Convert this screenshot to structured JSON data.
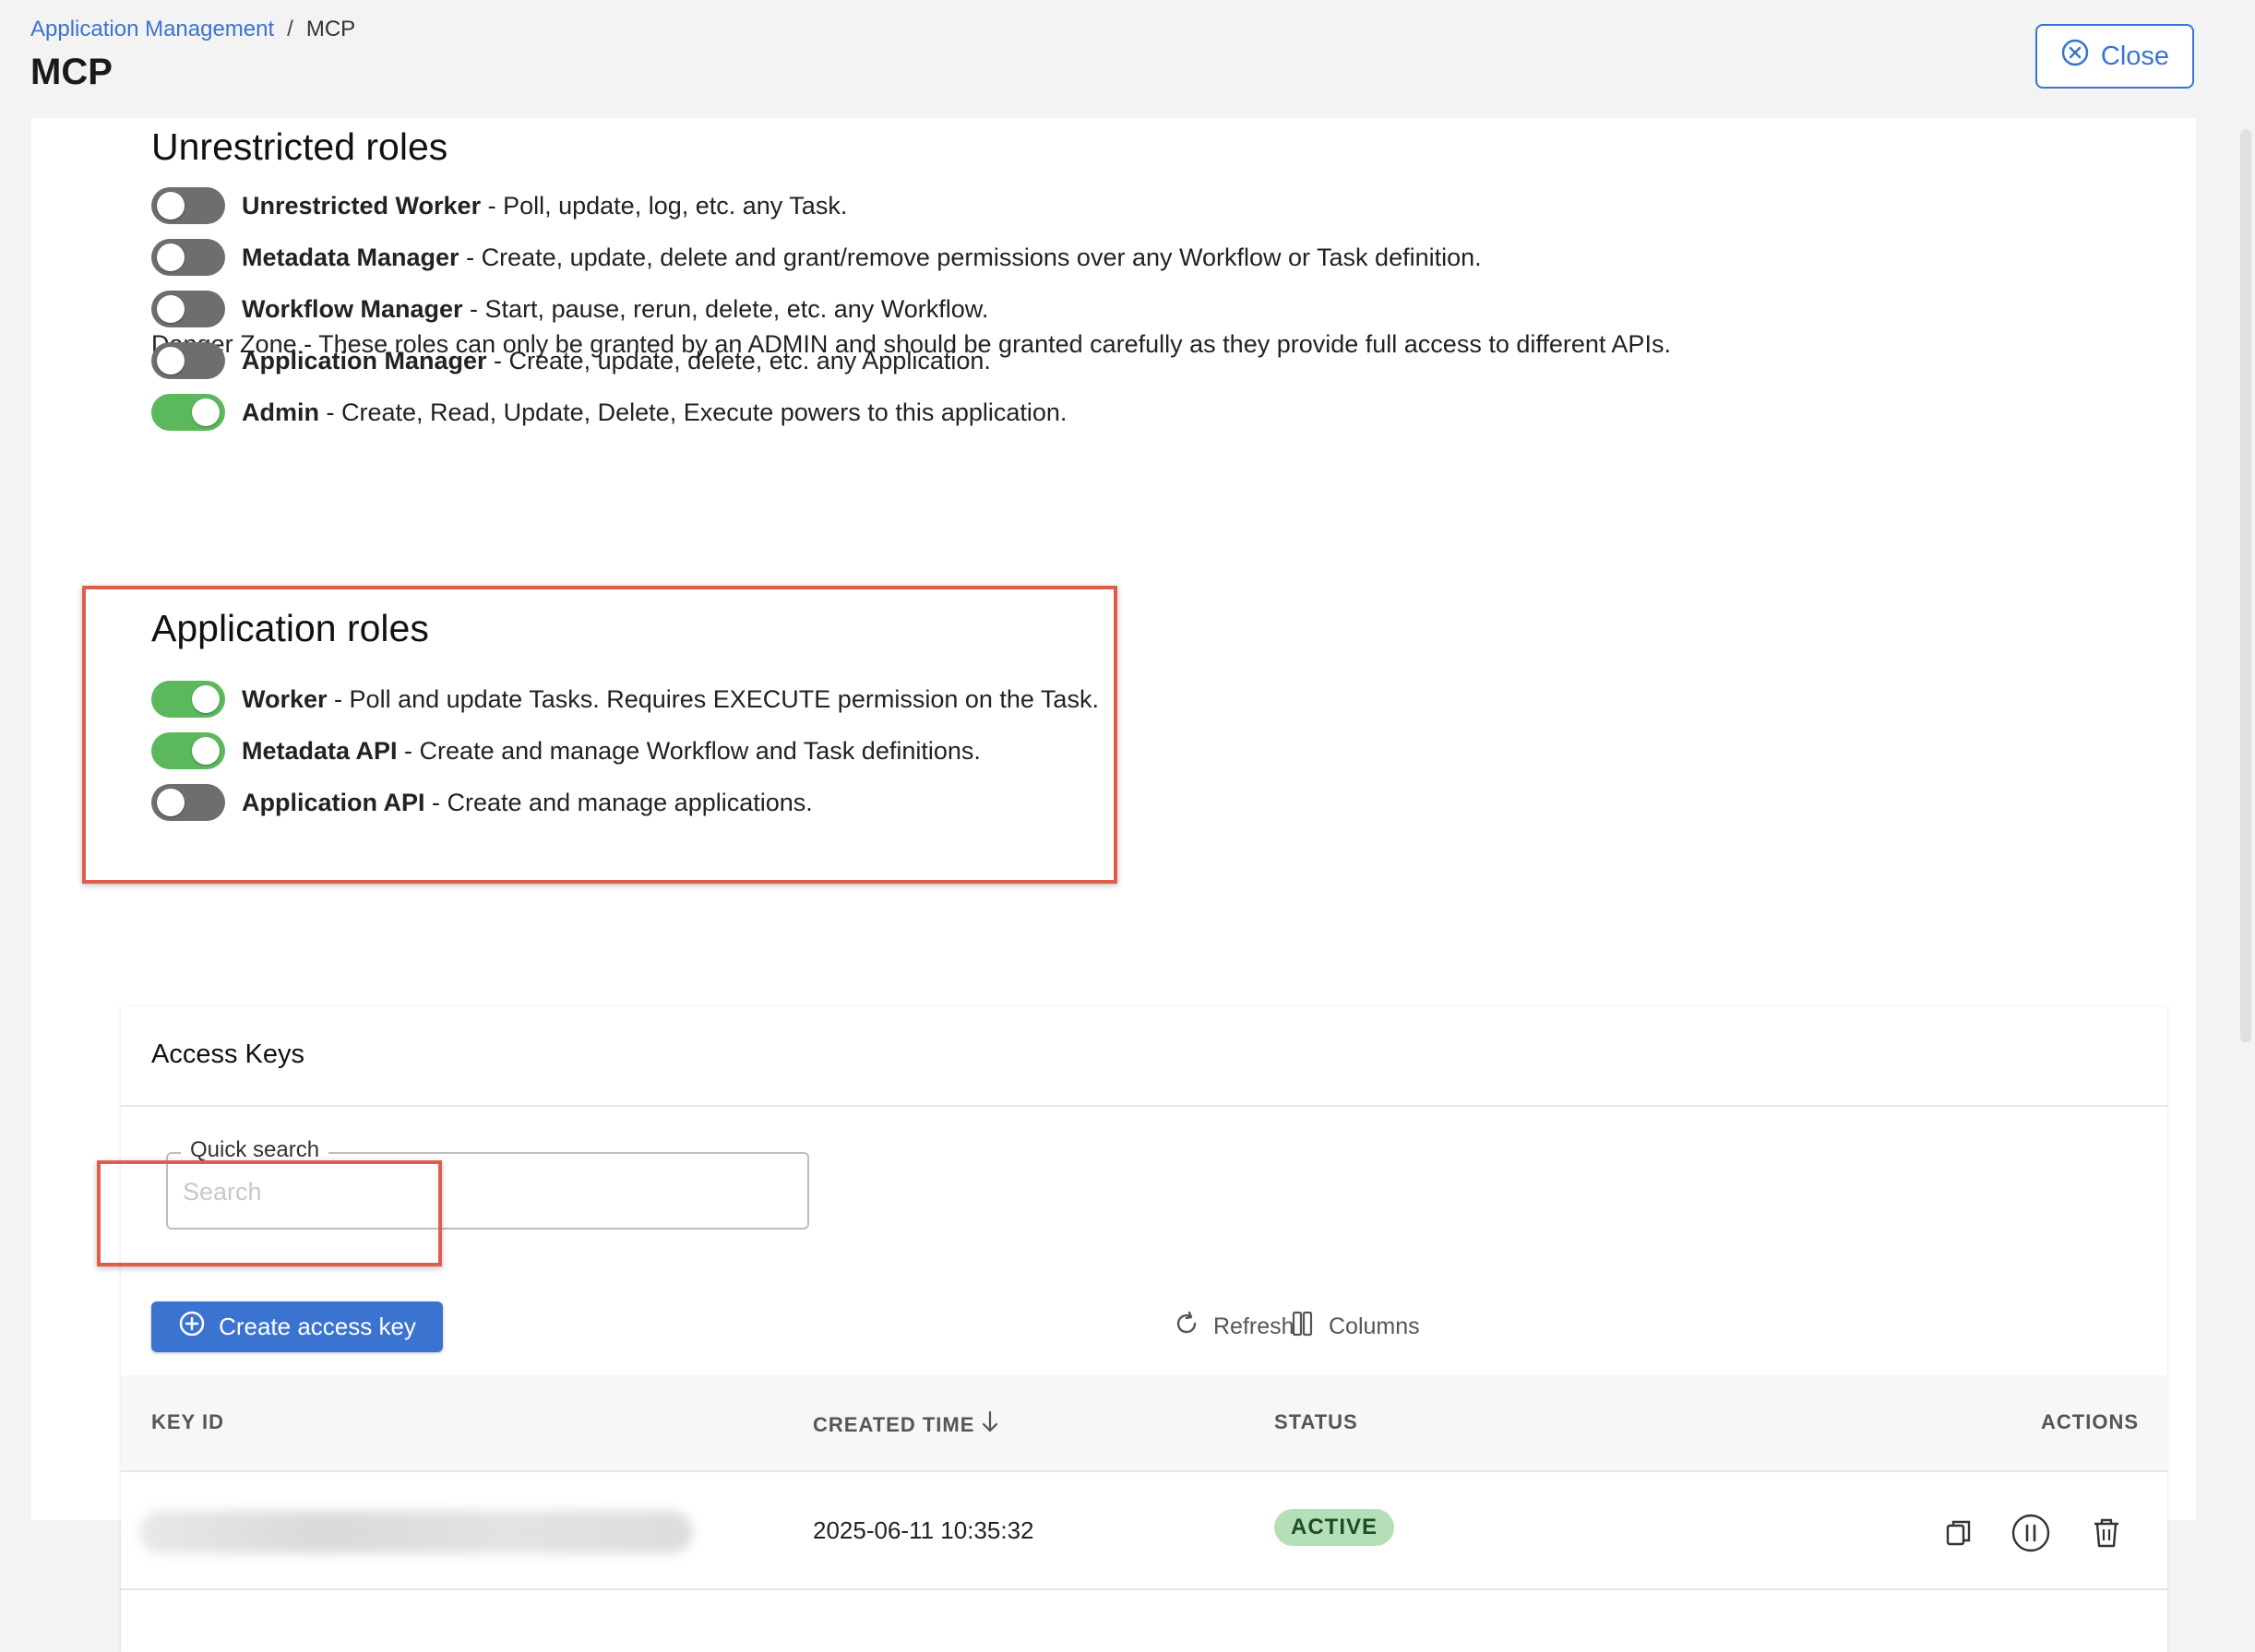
{
  "breadcrumb": {
    "parent": "Application Management",
    "separator": "/",
    "current": "MCP"
  },
  "page": {
    "title": "MCP"
  },
  "header": {
    "close_label": "Close"
  },
  "unrestricted": {
    "title": "Unrestricted roles",
    "description": "Danger Zone - These roles can only be granted by an ADMIN and should be granted carefully as they provide full access to different APIs.",
    "roles": [
      {
        "name": "Unrestricted Worker",
        "description": " - Poll, update, log, etc. any Task.",
        "enabled": false
      },
      {
        "name": "Metadata Manager",
        "description": " - Create, update, delete and grant/remove permissions over any Workflow or Task definition.",
        "enabled": false
      },
      {
        "name": "Workflow Manager",
        "description": " - Start, pause, rerun, delete, etc. any Workflow.",
        "enabled": false
      },
      {
        "name": "Application Manager",
        "description": " - Create, update, delete, etc. any Application.",
        "enabled": false
      },
      {
        "name": "Admin",
        "description": " - Create, Read, Update, Delete, Execute powers to this application.",
        "enabled": true
      }
    ]
  },
  "application_roles": {
    "title": "Application roles",
    "roles": [
      {
        "name": "Worker",
        "description": " - Poll and update Tasks. Requires EXECUTE permission on the Task.",
        "enabled": true
      },
      {
        "name": "Metadata API",
        "description": " - Create and manage Workflow and Task definitions.",
        "enabled": true
      },
      {
        "name": "Application API",
        "description": " - Create and manage applications.",
        "enabled": false
      }
    ]
  },
  "access_keys": {
    "title": "Access Keys",
    "search": {
      "label": "Quick search",
      "placeholder": "Search",
      "value": ""
    },
    "create_label": "Create access key",
    "refresh_label": "Refresh",
    "columns_label": "Columns",
    "headers": {
      "key_id": "KEY ID",
      "created_time": "CREATED TIME",
      "status": "STATUS",
      "actions": "ACTIONS"
    },
    "rows": [
      {
        "key_id": "",
        "created_time": "2025-06-11 10:35:32",
        "status": "ACTIVE"
      }
    ]
  },
  "colors": {
    "accent": "#3b73d1",
    "toggle_on": "#5cb85c",
    "toggle_off": "#6e6e6e",
    "highlight": "#e05c4d",
    "status_active_bg": "#b5e0b7"
  },
  "icons": {
    "close": "close-circle-icon",
    "create": "plus-circle-icon",
    "refresh": "refresh-icon",
    "columns": "columns-icon",
    "sort": "arrow-down-icon",
    "copy": "copy-icon",
    "pause": "pause-circle-icon",
    "delete": "trash-icon"
  }
}
